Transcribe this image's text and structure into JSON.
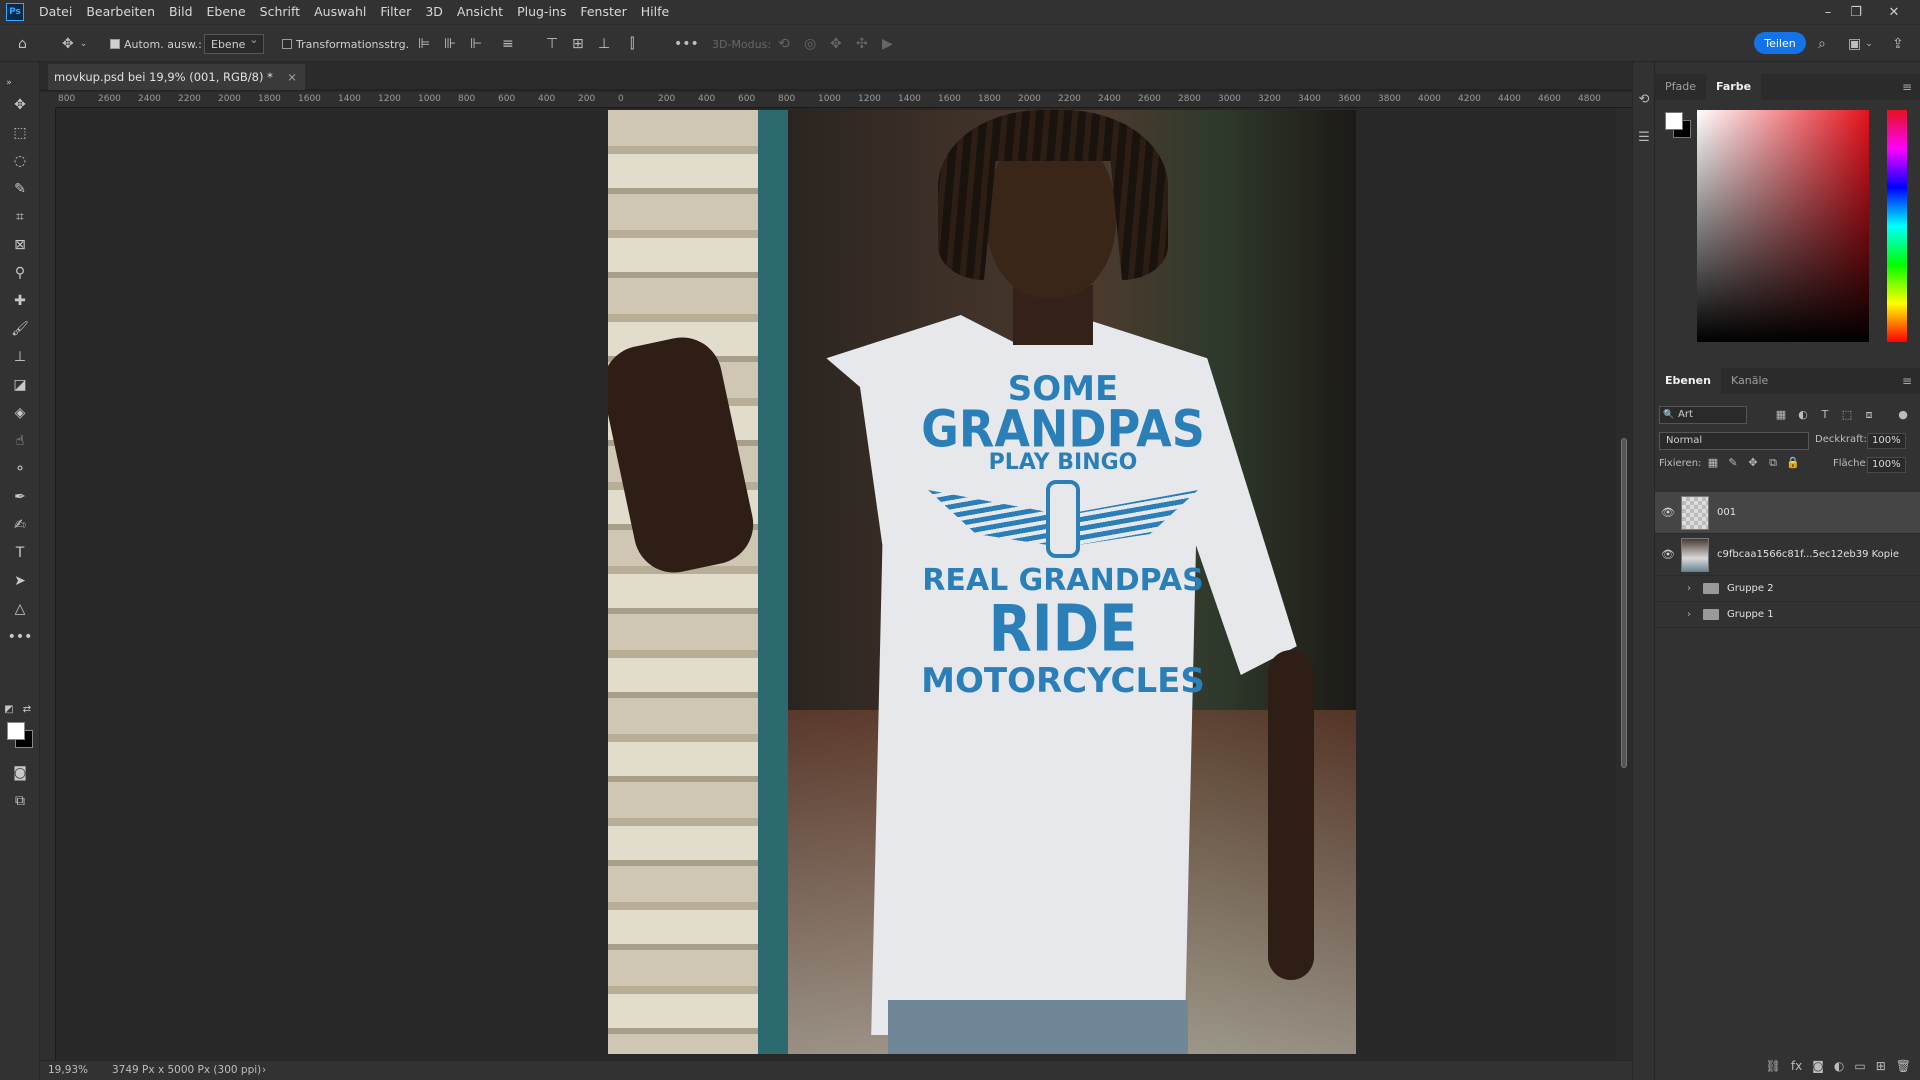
{
  "menubar": {
    "app_logo": "Ps",
    "items": [
      "Datei",
      "Bearbeiten",
      "Bild",
      "Ebene",
      "Schrift",
      "Auswahl",
      "Filter",
      "3D",
      "Ansicht",
      "Plug-ins",
      "Fenster",
      "Hilfe"
    ]
  },
  "options": {
    "auto_select_label": "Autom. ausw.:",
    "auto_select_checked": true,
    "target_value": "Ebene",
    "transform_label": "Transformationsstrg.",
    "mode_3d_label": "3D-Modus:",
    "share_label": "Teilen"
  },
  "document": {
    "tab_title": "movkup.psd bei 19,9% (001, RGB/8) *",
    "close_glyph": "×"
  },
  "ruler": {
    "h_labels": [
      "800",
      "2600",
      "2400",
      "2200",
      "2000",
      "1800",
      "1600",
      "1400",
      "1200",
      "1000",
      "800",
      "600",
      "400",
      "200",
      "0",
      "200",
      "400",
      "600",
      "800",
      "1000",
      "1200",
      "1400",
      "1600",
      "1800",
      "2000",
      "2200",
      "2400",
      "2600",
      "2800",
      "3000",
      "3200",
      "3400",
      "3600",
      "3800",
      "4000",
      "4200",
      "4400",
      "4600",
      "4800"
    ]
  },
  "artwork": {
    "line1": "SOME",
    "line2": "GRANDPAS",
    "line3": "PLAY BINGO",
    "line4": "REAL GRANDPAS",
    "line5": "RIDE",
    "line6": "MOTORCYCLES",
    "print_color": "#2b7fb8"
  },
  "status": {
    "zoom": "19,93%",
    "doc_size": "3749 Px x 5000 Px (300 ppi)",
    "arrow": "›"
  },
  "color_panel": {
    "tabs": [
      "Pfade",
      "Farbe"
    ],
    "active_tab": "Farbe",
    "hue_color": "#e5121c"
  },
  "layers_panel": {
    "tabs": [
      "Ebenen",
      "Kanäle"
    ],
    "active_tab": "Ebenen",
    "kind_filter": "Art",
    "blend_mode": "Normal",
    "opacity_label": "Deckkraft:",
    "opacity_value": "100%",
    "lock_label": "Fixieren:",
    "fill_label": "Fläche:",
    "fill_value": "100%",
    "layers": [
      {
        "name": "001",
        "visible": true,
        "type": "smart",
        "selected": true
      },
      {
        "name": "c9fbcaa1566c81f...5ec12eb39 Kopie",
        "visible": true,
        "type": "pixel",
        "selected": false
      },
      {
        "name": "Gruppe 2",
        "visible": false,
        "type": "group",
        "selected": false
      },
      {
        "name": "Gruppe 1",
        "visible": false,
        "type": "group",
        "selected": false
      }
    ]
  }
}
